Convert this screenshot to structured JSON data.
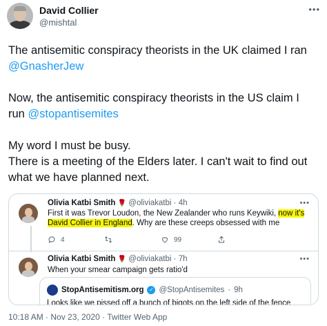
{
  "author": {
    "name": "David Collier",
    "handle": "@mishtal",
    "more_icon": "more-icon"
  },
  "tweet": {
    "line1_pre": "The antisemitic conspiracy theorists in the UK claimed I ran ",
    "mention1": "@GnasherJew",
    "line2_pre": "Now, the antisemitic conspiracy theorists in the US claim I run ",
    "mention2": "@stopantisemites",
    "line3": "My word I must be busy.",
    "line4": "There is a meeting of the Elders later. I can't wait to find out what we have planned next."
  },
  "embedded": {
    "first": {
      "name": "Olivia Katbi Smith",
      "rose": "🌹",
      "handle": "@oliviakatbi",
      "sep": "·",
      "time": "4h",
      "text_pre": "First it was Trevor Loudon, the New Zealander who runs Keywiki, ",
      "text_hl1": "now it's",
      "text_hl2": "David Collier in England",
      "text_post": ". Why are these creeps obsessed with me",
      "reply_count": "4",
      "like_count": "99"
    },
    "second": {
      "name": "Olivia Katbi Smith",
      "rose": "🌹",
      "handle": "@oliviakatbi",
      "sep": "·",
      "time": "7h",
      "text": "When your smear campaign gets ratio'd"
    },
    "quoted": {
      "name": "StopAntisemitism.org",
      "verified_mark": "✓",
      "handle": "@StopAntisemites",
      "sep": "·",
      "time": "9h",
      "text": "Looks like we pissed off a bunch of bigots on the left side of the fence"
    }
  },
  "footer": {
    "timestamp": "10:18 AM · Nov 23, 2020 · Twitter Web App"
  },
  "colors": {
    "link": "#1d9bf0",
    "highlight": "#f7f600",
    "muted": "#536471",
    "border": "#cfd9de"
  }
}
